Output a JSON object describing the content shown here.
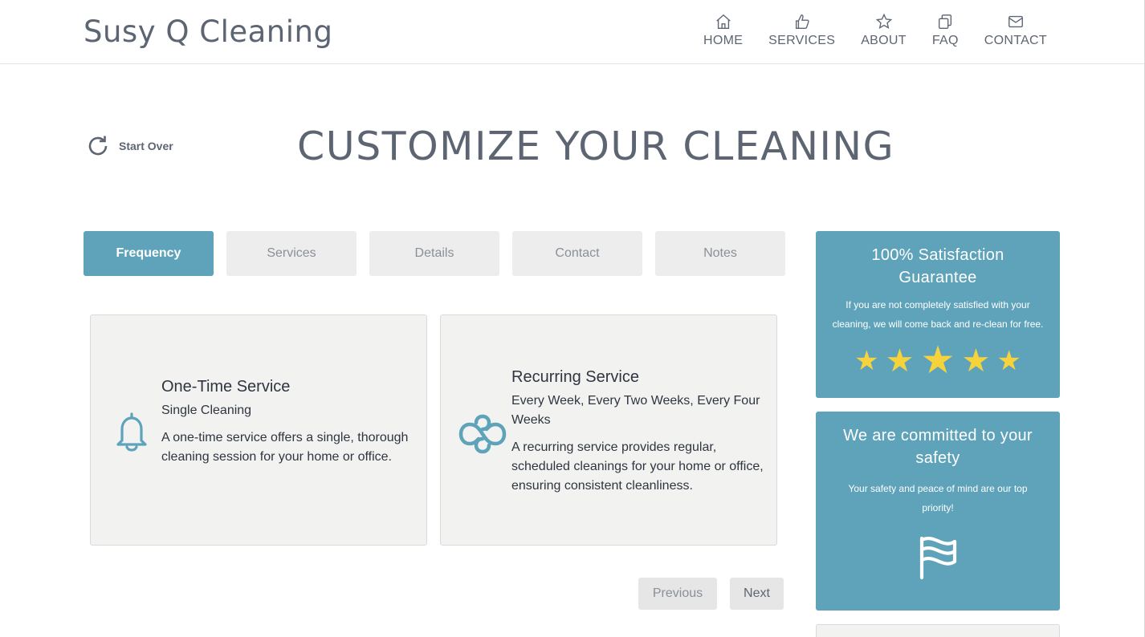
{
  "brand": "Susy Q Cleaning",
  "nav": [
    {
      "label": "HOME",
      "icon": "home-icon"
    },
    {
      "label": "SERVICES",
      "icon": "thumbs-up-icon"
    },
    {
      "label": "ABOUT",
      "icon": "star-icon"
    },
    {
      "label": "FAQ",
      "icon": "copy-icon"
    },
    {
      "label": "CONTACT",
      "icon": "envelope-icon"
    }
  ],
  "start_over": "Start Over",
  "page_title": "CUSTOMIZE YOUR CLEANING",
  "tabs": [
    {
      "label": "Frequency",
      "active": true
    },
    {
      "label": "Services",
      "active": false
    },
    {
      "label": "Details",
      "active": false
    },
    {
      "label": "Contact",
      "active": false
    },
    {
      "label": "Notes",
      "active": false
    }
  ],
  "options": [
    {
      "title": "One-Time Service",
      "subtitle": "Single Cleaning",
      "description": "A one-time service offers a single, thorough cleaning session for your home or office.",
      "icon": "bell-icon"
    },
    {
      "title": "Recurring Service",
      "subtitle": "Every Week, Every Two Weeks, Every Four Weeks",
      "description": "A recurring service provides regular, scheduled cleanings for your home or office, ensuring consistent cleanliness.",
      "icon": "infinity-link-icon"
    }
  ],
  "buttons": {
    "previous": "Previous",
    "next": "Next"
  },
  "guarantee": {
    "title": "100% Satisfaction Guarantee",
    "text": "If you are not completely satisfied with your cleaning, we will come back and re-clean for free.",
    "stars": 5
  },
  "safety": {
    "title": "We are committed to your safety",
    "text": "Your safety and peace of mind are our top priority!",
    "icon": "flag-icon"
  },
  "colors": {
    "accent": "#5ea3ba",
    "star": "#f6d33c",
    "text": "#5d6573"
  }
}
